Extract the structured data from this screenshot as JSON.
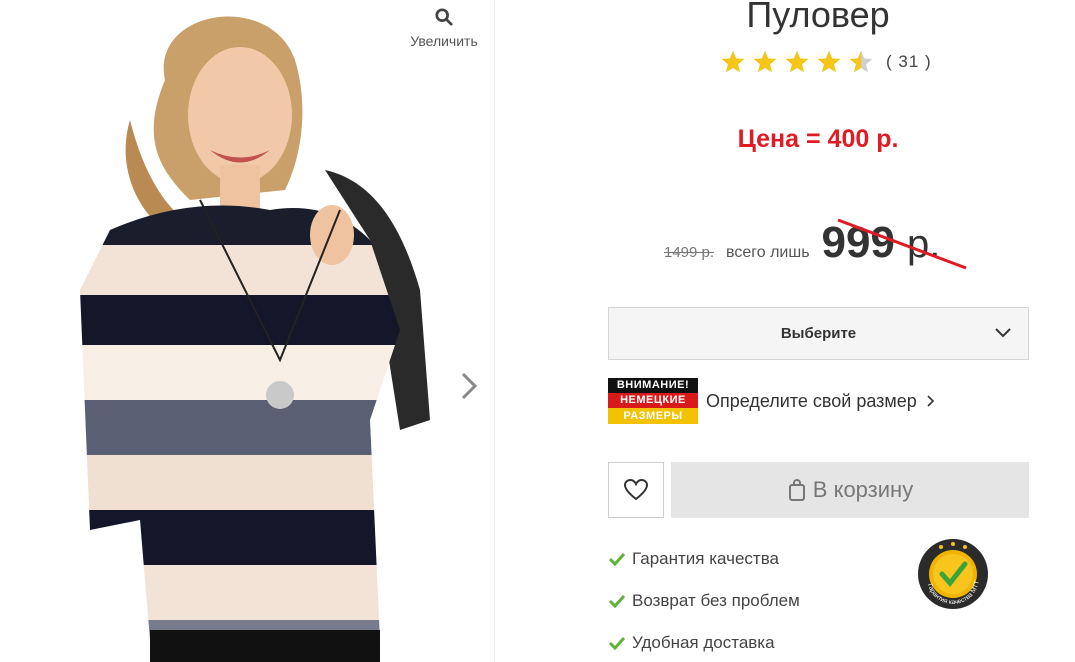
{
  "gallery": {
    "zoom_label": "Увеличить",
    "zoom_icon": "search-icon",
    "next_icon": "chevron-right-icon",
    "photo_alt": "Пуловер"
  },
  "product": {
    "title": "Пуловер",
    "rating": 4.5,
    "rating_max": 5,
    "rating_count": "( 31 )",
    "promo_price": "Цена = 400 р.",
    "old_price": "1499 р.",
    "only_label": "всего лишь",
    "new_price": "999",
    "currency": "р."
  },
  "size_select": {
    "label": "Выберите"
  },
  "size_guide": {
    "badge_line1": "ВНИМАНИЕ!",
    "badge_line2": "НЕМЕЦКИЕ",
    "badge_line3": "РАЗМЕРЫ",
    "label": "Определите свой размер"
  },
  "actions": {
    "wishlist_icon": "heart-icon",
    "cart_label": "В корзину",
    "cart_icon": "bag-icon"
  },
  "benefits": [
    {
      "label": "Гарантия качества"
    },
    {
      "label": "Возврат без проблем"
    },
    {
      "label": "Удобная доставка"
    }
  ],
  "seal": {
    "text": "Гарантия качества MTT"
  },
  "colors": {
    "promo": "#e01b24",
    "star": "#f5c518",
    "tick": "#5cb338",
    "strike": "#e01b24"
  }
}
